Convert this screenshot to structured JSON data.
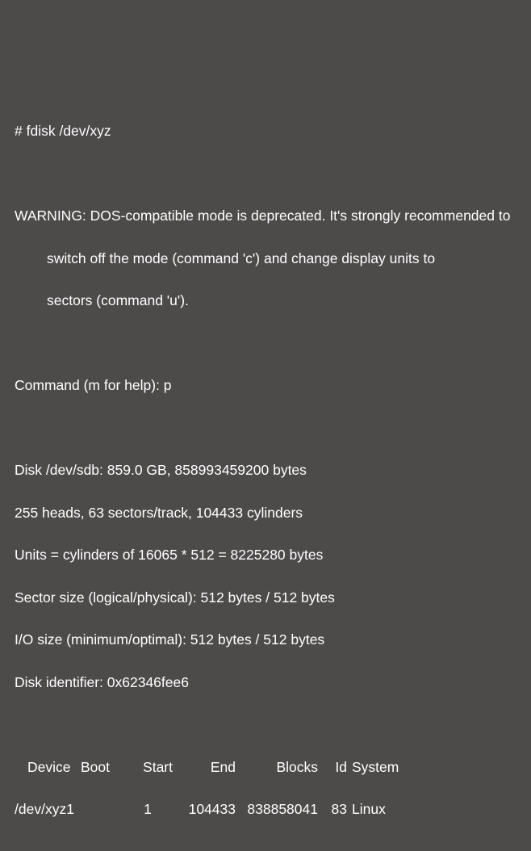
{
  "cmd_line": "# fdisk /dev/xyz",
  "warning": {
    "l1": "WARNING: DOS-compatible mode is deprecated. It's strongly recommended to",
    "l2": "switch off the mode (command 'c') and change display units to",
    "l3": "sectors (command 'u')."
  },
  "prompt": {
    "label": "Command (m for help): ",
    "input": "p"
  },
  "disk": {
    "l1": "Disk /dev/sdb: 859.0 GB, 858993459200 bytes",
    "l2": "255 heads, 63 sectors/track, 104433 cylinders",
    "l3": "Units = cylinders of 16065 * 512 = 8225280 bytes",
    "l4": "Sector size (logical/physical): 512 bytes / 512 bytes",
    "l5": "I/O size (minimum/optimal): 512 bytes / 512 bytes",
    "l6": "Disk identifier: 0x62346fee6"
  },
  "table": {
    "headers": {
      "device": "Device",
      "boot": "Boot",
      "start": "Start",
      "end": "End",
      "blocks": "Blocks",
      "id": "Id",
      "system": "System"
    },
    "row": {
      "device": "/dev/xyz1",
      "boot": "",
      "start": "1",
      "end": "104433",
      "blocks": "838858041",
      "id": "83",
      "system": "Linux"
    }
  }
}
